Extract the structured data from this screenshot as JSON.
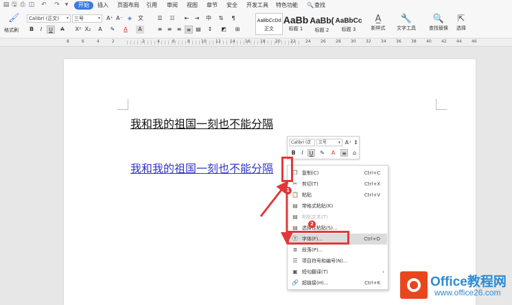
{
  "menubar": {
    "tabs": [
      "开始",
      "插入",
      "页面布局",
      "引用",
      "审阅",
      "视图",
      "章节",
      "安全",
      "开发工具",
      "特色功能"
    ],
    "active_tab": "开始",
    "search_label": "查找"
  },
  "ribbon": {
    "format_painter": "格式刷",
    "font_name": "Calibri (正文)",
    "font_size": "三号",
    "styles": [
      {
        "sample": "AaBbCcDd",
        "name": "正文"
      },
      {
        "sample": "AaBb",
        "name": "标题 1"
      },
      {
        "sample": "AaBb(",
        "name": "标题 2"
      },
      {
        "sample": "AaBbCc",
        "name": "标题 3"
      }
    ],
    "new_style": "新样式",
    "text_tools": "文字工具",
    "find_replace": "查找替换",
    "select": "选择"
  },
  "ruler": {
    "numbers": [
      "8",
      "6",
      "4",
      "2",
      "2",
      "4",
      "6",
      "8",
      "10",
      "12",
      "14",
      "16",
      "18",
      "20",
      "22",
      "24",
      "26",
      "28",
      "30",
      "32",
      "34",
      "36",
      "38",
      "40",
      "42",
      "44",
      "46"
    ]
  },
  "document": {
    "line1": "我和我的祖国一刻也不能分隔",
    "line2": "我和我的祖国一刻也不能分隔"
  },
  "mini_toolbar": {
    "font_name": "Calibri (正",
    "font_size": "三号"
  },
  "context_menu": {
    "items": [
      {
        "label": "复制(C)",
        "shortcut": "Ctrl+C",
        "icon": "copy-icon",
        "glyph": "❐"
      },
      {
        "label": "剪切(T)",
        "shortcut": "Ctrl+X",
        "icon": "cut-icon",
        "glyph": "✂"
      },
      {
        "label": "粘贴",
        "shortcut": "Ctrl+V",
        "icon": "paste-icon",
        "glyph": "📋"
      },
      {
        "label": "带格式粘贴(K)",
        "shortcut": "",
        "icon": "paste-format-icon",
        "glyph": "▤"
      },
      {
        "label": "粘贴文本(T)",
        "shortcut": "",
        "icon": "paste-text-icon",
        "glyph": "▤"
      },
      {
        "label": "选择性粘贴(S)...",
        "shortcut": "",
        "icon": "paste-special-icon",
        "glyph": "▤"
      },
      {
        "label": "字体(F)...",
        "shortcut": "Ctrl+D",
        "icon": "font-icon",
        "glyph": "Ⓣ"
      },
      {
        "label": "段落(P)...",
        "shortcut": "",
        "icon": "paragraph-icon",
        "glyph": "≣"
      },
      {
        "label": "项目符号和编号(N)...",
        "shortcut": "",
        "icon": "bullets-icon",
        "glyph": "☰"
      },
      {
        "label": "短句翻译(T)",
        "shortcut": "",
        "icon": "translate-icon",
        "glyph": "▣"
      },
      {
        "label": "超链接(H)...",
        "shortcut": "Ctrl+K",
        "icon": "hyperlink-icon",
        "glyph": "🔗"
      }
    ]
  },
  "annotations": {
    "badge1": "1",
    "badge2": "2",
    "color": "#e0383a"
  },
  "watermark": {
    "brand": "Office教程网",
    "site": "www.office26.com"
  }
}
